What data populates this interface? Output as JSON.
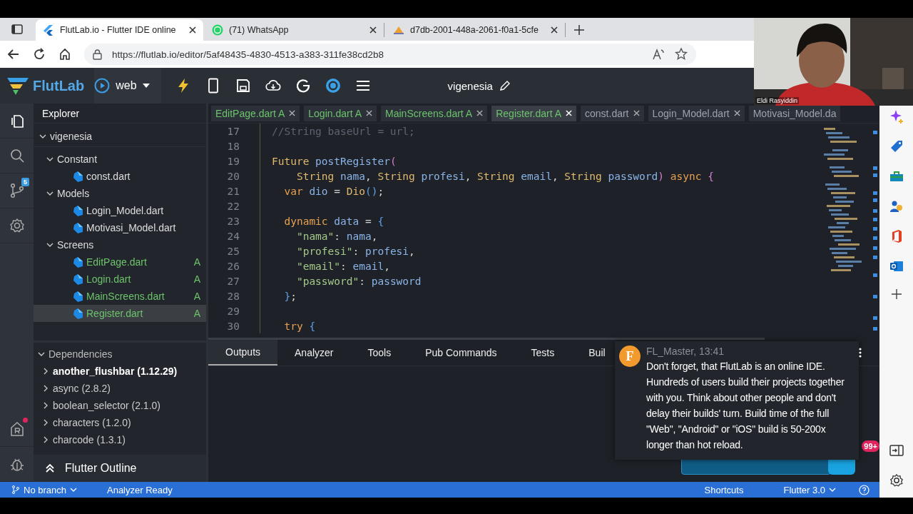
{
  "browser": {
    "tabs": [
      {
        "label": "FlutLab.io - Flutter IDE online",
        "kind": "flutlab",
        "selected": true
      },
      {
        "label": "(71) WhatsApp",
        "kind": "whatsapp",
        "selected": false
      },
      {
        "label": "d7db-2001-448a-2061-f0a1-5cfe",
        "kind": "pma",
        "selected": false
      }
    ],
    "url": "https://flutlab.io/editor/5af48435-4830-4513-a383-311fe38cd2b8"
  },
  "webcam": {
    "kind": "picture",
    "name": "Eldi Rasyiddin"
  },
  "header": {
    "logo": "FlutLab",
    "target": "web",
    "project": "vigenesia"
  },
  "activity": {
    "git_badge": "5"
  },
  "explorer": {
    "title": "Explorer",
    "tree": [
      {
        "label": "vigenesia",
        "kind": "project",
        "expanded": true,
        "selected": false,
        "children": [
          {
            "label": "Constant",
            "kind": "folder",
            "expanded": true,
            "selected": false,
            "children": [
              {
                "label": "const.dart",
                "kind": "file",
                "selected": false
              }
            ]
          },
          {
            "label": "Models",
            "kind": "folder",
            "expanded": true,
            "selected": false,
            "children": [
              {
                "label": "Login_Model.dart",
                "kind": "file",
                "selected": false
              },
              {
                "label": "Motivasi_Model.dart",
                "kind": "file",
                "selected": false
              }
            ]
          },
          {
            "label": "Screens",
            "kind": "folder",
            "expanded": true,
            "selected": false,
            "children": [
              {
                "label": "EditPage.dart",
                "kind": "file",
                "status": "A",
                "selected": false
              },
              {
                "label": "Login.dart",
                "kind": "file",
                "status": "A",
                "selected": false
              },
              {
                "label": "MainScreens.dart",
                "kind": "file",
                "status": "A",
                "selected": false
              },
              {
                "label": "Register.dart",
                "kind": "file",
                "status": "A",
                "selected": true
              }
            ]
          }
        ]
      }
    ],
    "dependencies": {
      "title": "Dependencies",
      "expanded": true,
      "items": [
        {
          "label": "another_flushbar (1.12.29)",
          "expanded": false,
          "selected": true
        },
        {
          "label": "async (2.8.2)",
          "expanded": false,
          "selected": false
        },
        {
          "label": "boolean_selector (2.1.0)",
          "expanded": false,
          "selected": false
        },
        {
          "label": "characters (1.2.0)",
          "expanded": false,
          "selected": false
        },
        {
          "label": "charcode (1.3.1)",
          "expanded": false,
          "selected": false
        }
      ]
    },
    "outline": {
      "title": "Flutter Outline"
    }
  },
  "editor": {
    "tabs": [
      {
        "label": "EditPage.dart A",
        "added": true,
        "selected": false
      },
      {
        "label": "Login.dart A",
        "added": true,
        "selected": false
      },
      {
        "label": "MainScreens.dart A",
        "added": true,
        "selected": false
      },
      {
        "label": "Register.dart A",
        "added": true,
        "selected": true
      },
      {
        "label": "const.dart",
        "added": false,
        "selected": false
      },
      {
        "label": "Login_Model.dart",
        "added": false,
        "selected": false
      },
      {
        "label": "Motivasi_Model.da",
        "added": false,
        "selected": false
      }
    ],
    "lines": [
      {
        "number": "17",
        "tokens": [
          {
            "t": "//String baseUrl = url;",
            "kind": "comment"
          }
        ]
      },
      {
        "number": "18"
      },
      {
        "number": "19",
        "tokens": [
          {
            "t": "Future ",
            "kind": "type"
          },
          {
            "t": "postRegister",
            "kind": "ident"
          },
          {
            "t": "(",
            "kind": "paren"
          }
        ]
      },
      {
        "number": "20",
        "tokens": [
          {
            "t": "    String ",
            "kind": "type"
          },
          {
            "t": "nama",
            "kind": "ident"
          },
          {
            "t": ", ",
            "kind": "punct"
          },
          {
            "t": "String ",
            "kind": "type"
          },
          {
            "t": "profesi",
            "kind": "ident"
          },
          {
            "t": ", ",
            "kind": "punct"
          },
          {
            "t": "String ",
            "kind": "type"
          },
          {
            "t": "email",
            "kind": "ident"
          },
          {
            "t": ", ",
            "kind": "punct"
          },
          {
            "t": "String ",
            "kind": "type"
          },
          {
            "t": "password",
            "kind": "ident"
          },
          {
            "t": ")",
            "kind": "paren"
          },
          {
            "t": " async ",
            "kind": "keyword"
          },
          {
            "t": "{",
            "kind": "paren"
          }
        ]
      },
      {
        "number": "21",
        "tokens": [
          {
            "t": "  var ",
            "kind": "keyword"
          },
          {
            "t": "dio",
            "kind": "ident"
          },
          {
            "t": " = ",
            "kind": "punct"
          },
          {
            "t": "Dio",
            "kind": "type"
          },
          {
            "t": "()",
            "kind": "brace"
          },
          {
            "t": ";",
            "kind": "punct"
          }
        ]
      },
      {
        "number": "22"
      },
      {
        "number": "23",
        "tokens": [
          {
            "t": "  dynamic ",
            "kind": "keyword"
          },
          {
            "t": "data",
            "kind": "ident"
          },
          {
            "t": " = ",
            "kind": "punct"
          },
          {
            "t": "{",
            "kind": "brace"
          }
        ]
      },
      {
        "number": "24",
        "tokens": [
          {
            "t": "    \"nama\"",
            "kind": "string"
          },
          {
            "t": ": ",
            "kind": "punct"
          },
          {
            "t": "nama",
            "kind": "ident"
          },
          {
            "t": ",",
            "kind": "punct"
          }
        ]
      },
      {
        "number": "25",
        "tokens": [
          {
            "t": "    \"profesi\"",
            "kind": "string"
          },
          {
            "t": ": ",
            "kind": "punct"
          },
          {
            "t": "profesi",
            "kind": "ident"
          },
          {
            "t": ",",
            "kind": "punct"
          }
        ]
      },
      {
        "number": "26",
        "tokens": [
          {
            "t": "    \"email\"",
            "kind": "string"
          },
          {
            "t": ": ",
            "kind": "punct"
          },
          {
            "t": "email",
            "kind": "ident"
          },
          {
            "t": ",",
            "kind": "punct"
          }
        ]
      },
      {
        "number": "27",
        "tokens": [
          {
            "t": "    \"password\"",
            "kind": "string"
          },
          {
            "t": ": ",
            "kind": "punct"
          },
          {
            "t": "password",
            "kind": "ident"
          }
        ]
      },
      {
        "number": "28",
        "tokens": [
          {
            "t": "  }",
            "kind": "brace"
          },
          {
            "t": ";",
            "kind": "punct"
          }
        ]
      },
      {
        "number": "29"
      },
      {
        "number": "30",
        "tokens": [
          {
            "t": "  try ",
            "kind": "keyword"
          },
          {
            "t": "{",
            "kind": "brace"
          }
        ]
      }
    ]
  },
  "panel": {
    "tabs": [
      {
        "label": "Outputs",
        "selected": true
      },
      {
        "label": "Analyzer",
        "selected": false
      },
      {
        "label": "Tools",
        "selected": false
      },
      {
        "label": "Pub Commands",
        "selected": false
      },
      {
        "label": "Tests",
        "selected": false
      },
      {
        "label": "Buil",
        "selected": false
      }
    ]
  },
  "notification": {
    "avatar": "F",
    "author": "FL_Master, 13:41",
    "message": "Don't forget, that FlutLab is an online IDE. Hundreds of users build their projects together with you. Think about other people and don't delay their builds' turn. Build time of the full \"Web\", \"Android\" or \"iOS\" build is 50-200x longer than hot reload."
  },
  "chat_badge": "99+",
  "status_bar": {
    "branch": "No branch",
    "analyzer": "Analyzer Ready",
    "shortcuts": "Shortcuts",
    "flutter": "Flutter 3.0"
  }
}
